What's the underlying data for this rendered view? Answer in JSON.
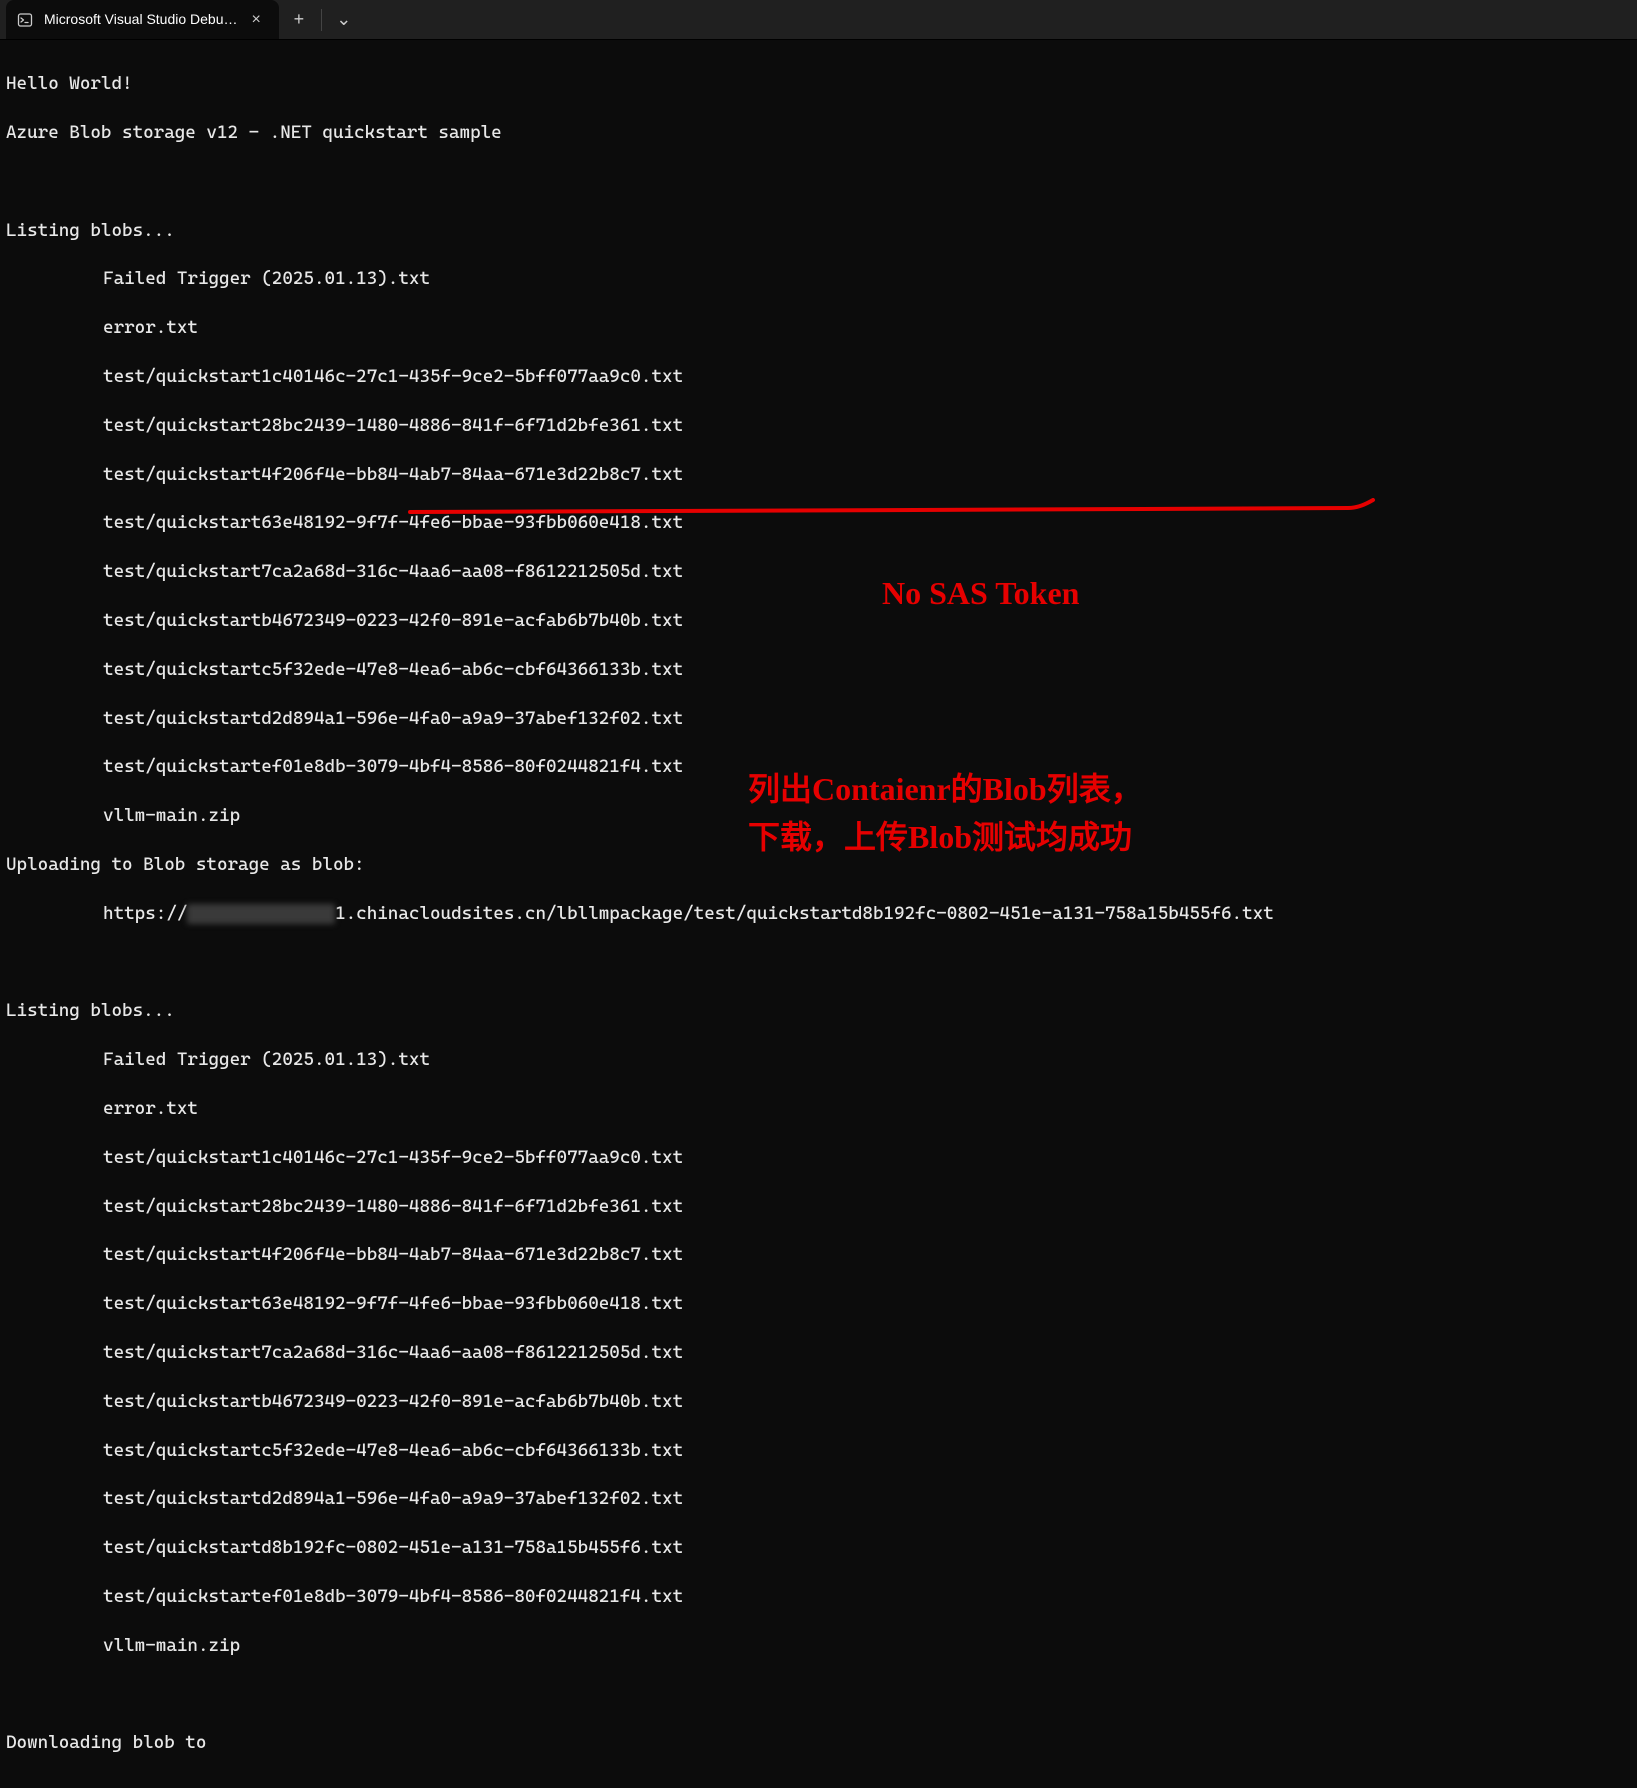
{
  "tabbar": {
    "tab_title": "Microsoft Visual Studio Debu…",
    "new_tab_glyph": "+",
    "dropdown_glyph": "⌄",
    "close_glyph": "×"
  },
  "terminal": {
    "lines": [
      "Hello World!",
      "Azure Blob storage v12 - .NET quickstart sample",
      "",
      "Listing blobs...",
      "Failed Trigger (2025.01.13).txt",
      "error.txt",
      "test/quickstart1c40146c-27c1-435f-9ce2-5bff077aa9c0.txt",
      "test/quickstart28bc2439-1480-4886-841f-6f71d2bfe361.txt",
      "test/quickstart4f206f4e-bb84-4ab7-84aa-671e3d22b8c7.txt",
      "test/quickstart63e48192-9f7f-4fe6-bbae-93fbb060e418.txt",
      "test/quickstart7ca2a68d-316c-4aa6-aa08-f8612212505d.txt",
      "test/quickstartb4672349-0223-42f0-891e-acfab6b7b40b.txt",
      "test/quickstartc5f32ede-47e8-4ea6-ab6c-cbf64366133b.txt",
      "test/quickstartd2d894a1-596e-4fa0-a9a9-37abef132f02.txt",
      "test/quickstartef01e8db-3079-4bf4-8586-80f0244821f4.txt",
      "vllm-main.zip",
      "Uploading to Blob storage as blob:"
    ],
    "url_prefix": "https://",
    "url_redacted": "██████████████",
    "url_suffix": "1.chinacloudsites.cn/lbllmpackage/test/quickstartd8b192fc-0802-451e-a131-758a15b455f6.txt",
    "lines2_header": "Listing blobs...",
    "lines2": [
      "Failed Trigger (2025.01.13).txt",
      "error.txt",
      "test/quickstart1c40146c-27c1-435f-9ce2-5bff077aa9c0.txt",
      "test/quickstart28bc2439-1480-4886-841f-6f71d2bfe361.txt",
      "test/quickstart4f206f4e-bb84-4ab7-84aa-671e3d22b8c7.txt",
      "test/quickstart63e48192-9f7f-4fe6-bbae-93fbb060e418.txt",
      "test/quickstart7ca2a68d-316c-4aa6-aa08-f8612212505d.txt",
      "test/quickstartb4672349-0223-42f0-891e-acfab6b7b40b.txt",
      "test/quickstartc5f32ede-47e8-4ea6-ab6c-cbf64366133b.txt",
      "test/quickstartd2d894a1-596e-4fa0-a9a9-37abef132f02.txt",
      "test/quickstartd8b192fc-0802-451e-a131-758a15b455f6.txt",
      "test/quickstartef01e8db-3079-4bf4-8586-80f0244821f4.txt",
      "vllm-main.zip"
    ],
    "download_header": "Downloading blob to"
  },
  "annotations": {
    "no_sas": "No SAS Token",
    "cn_line1": "列出Contaienr的Blob列表，",
    "cn_line2": "下载，上传Blob测试均成功"
  }
}
